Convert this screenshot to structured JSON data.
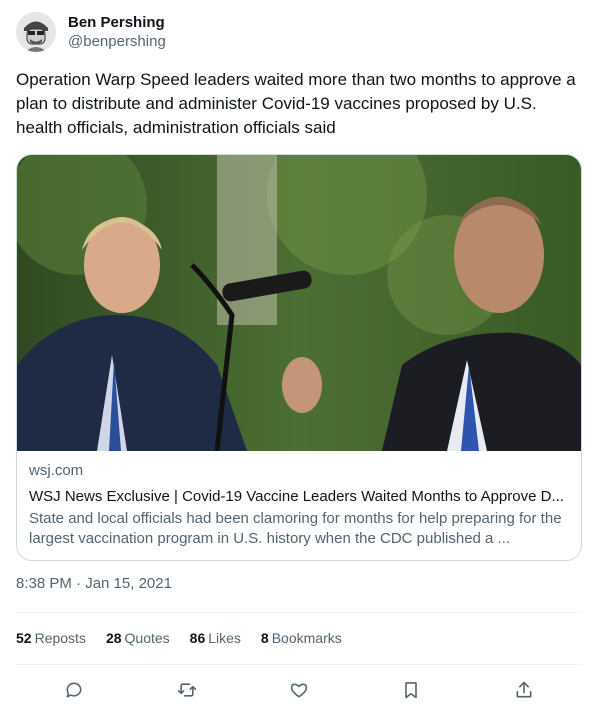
{
  "author": {
    "name": "Ben Pershing",
    "handle": "@benpershing"
  },
  "tweet": {
    "text": "Operation Warp Speed leaders waited more than two months to approve a plan to distribute and administer Covid-19 vaccines proposed by U.S. health officials, administration officials said",
    "timestamp": "8:38 PM · Jan 15, 2021"
  },
  "card": {
    "domain": "wsj.com",
    "title": "WSJ News Exclusive | Covid-19 Vaccine Leaders Waited Months to Approve D...",
    "description": "State and local officials had been clamoring for months for help preparing for the largest vaccination program in U.S. history when the CDC published a ..."
  },
  "stats": {
    "reposts": {
      "count": "52",
      "label": "Reposts"
    },
    "quotes": {
      "count": "28",
      "label": "Quotes"
    },
    "likes": {
      "count": "86",
      "label": "Likes"
    },
    "bookmarks": {
      "count": "8",
      "label": "Bookmarks"
    }
  },
  "actions": [
    "reply-icon",
    "repost-icon",
    "like-icon",
    "bookmark-icon",
    "share-icon"
  ],
  "colors": {
    "text": "#0f1419",
    "secondary": "#536471",
    "border": "#cfd9de",
    "divider": "#eff3f4"
  }
}
